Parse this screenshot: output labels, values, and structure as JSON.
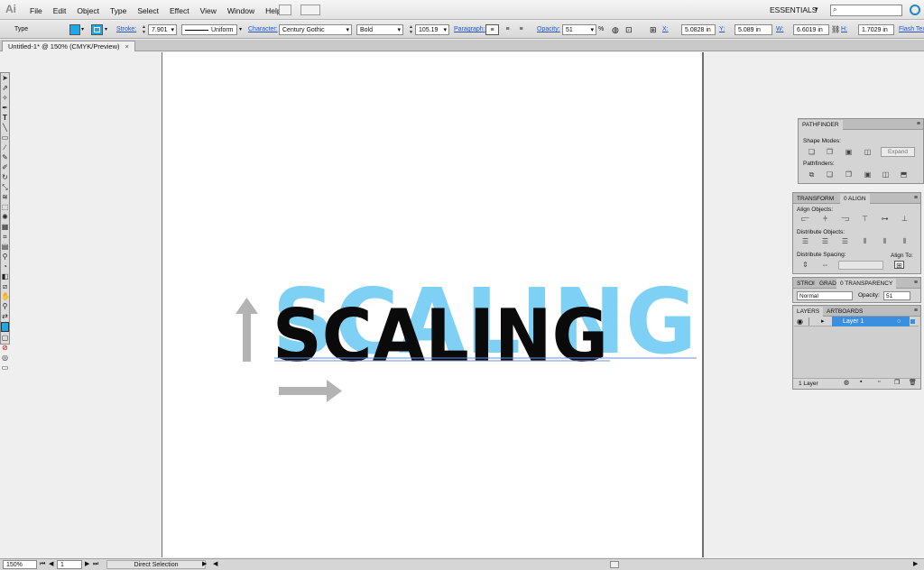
{
  "app": {
    "logo": "Ai",
    "menus": [
      "File",
      "Edit",
      "Object",
      "Type",
      "Select",
      "Effect",
      "View",
      "Window",
      "Help"
    ],
    "workspace": "ESSENTIALS",
    "search_placeholder": ""
  },
  "control": {
    "type_label": "Type",
    "stroke_label": "Stroke:",
    "stroke_value": "7.901",
    "stroke_profile": "Uniform",
    "character_label": "Character:",
    "font_family": "Century Gothic",
    "font_style": "Bold",
    "font_size": "105.19",
    "paragraph_label": "Paragraph:",
    "opacity_label": "Opacity:",
    "opacity_value": "51",
    "percent": "%",
    "x_label": "X:",
    "x_value": "5.0828 in",
    "y_label": "Y:",
    "y_value": "5.089 in",
    "w_label": "W:",
    "w_value": "6.6019 in",
    "h_label": "H:",
    "h_value": "1.7029 in",
    "flash_label": "Flash Tex"
  },
  "document": {
    "tab_title": "Untitled-1* @ 150% (CMYK/Preview)",
    "close": "×"
  },
  "artwork": {
    "text_main": "SCALING",
    "text_ghost": "SCALING"
  },
  "pathfinder": {
    "title": "PATHFINDER",
    "shape_modes": "Shape Modes:",
    "pathfinders": "Pathfinders:",
    "expand": "Expand"
  },
  "align": {
    "tab_transform": "TRANSFORM",
    "tab_align": "0 ALIGN",
    "align_objects": "Align Objects:",
    "distribute_objects": "Distribute Objects:",
    "distribute_spacing": "Distribute Spacing:",
    "align_to": "Align To:"
  },
  "transparency": {
    "tab_stroke": "STROI",
    "tab_gradient": "GRAD",
    "tab_transparency": "0 TRANSPARENCY",
    "blend_mode": "Normal",
    "opacity_label": "Opacity:",
    "opacity_value": "51"
  },
  "layers": {
    "tab_layers": "LAYERS",
    "tab_artboards": "ARTBOARDS",
    "layer_name": "Layer 1",
    "count": "1 Layer"
  },
  "status": {
    "zoom": "150%",
    "artboard": "1",
    "tool": "Direct Selection"
  },
  "colors": {
    "fill": "#1ea8e8",
    "ghost": "#7fd0f5",
    "text": "#0a0a0a",
    "arrow": "#b3b3b3",
    "selection": "#3a8fe0"
  },
  "icons": [
    "selection-icon",
    "direct-selection-icon",
    "pen-icon",
    "type-icon",
    "rectangle-icon",
    "brush-icon",
    "pencil-icon",
    "rotate-icon",
    "scale-icon",
    "gradient-icon",
    "eyedropper-icon",
    "zoom-icon",
    "hand-icon",
    "fill-icon",
    "stroke-icon",
    "eye-icon",
    "lock-icon"
  ]
}
